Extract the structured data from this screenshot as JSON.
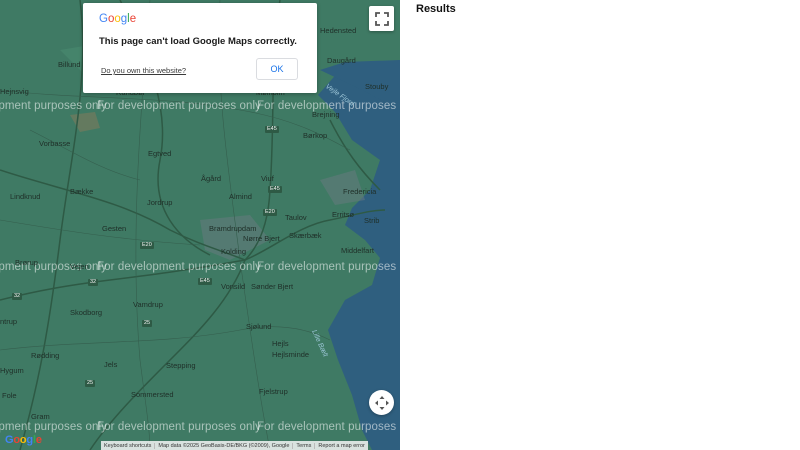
{
  "map": {
    "watermark": "For development purposes only",
    "sea_color": "#2f5f7f",
    "land_color": "#3f7a64",
    "places": [
      {
        "name": "Hedensted"
      },
      {
        "name": "Daugård"
      },
      {
        "name": "Billund"
      },
      {
        "name": "Stouby"
      },
      {
        "name": "Hejnsvig"
      },
      {
        "name": "Randbøl"
      },
      {
        "name": "Mølholm"
      },
      {
        "name": "Brejning"
      },
      {
        "name": "Børkop"
      },
      {
        "name": "Vorbasse"
      },
      {
        "name": "Egtved"
      },
      {
        "name": "Ågård"
      },
      {
        "name": "Viuf"
      },
      {
        "name": "Fredericia"
      },
      {
        "name": "Bække"
      },
      {
        "name": "Lindknud"
      },
      {
        "name": "Jordrup"
      },
      {
        "name": "Almind"
      },
      {
        "name": "Taulov"
      },
      {
        "name": "Erritsø"
      },
      {
        "name": "Strib"
      },
      {
        "name": "Gesten"
      },
      {
        "name": "Bramdrupdam"
      },
      {
        "name": "Skærbæk"
      },
      {
        "name": "Nørre Bjert"
      },
      {
        "name": "Middelfart"
      },
      {
        "name": "Kolding"
      },
      {
        "name": "Brørup"
      },
      {
        "name": "Vejen"
      },
      {
        "name": "Vonsild"
      },
      {
        "name": "Sønder Bjert"
      },
      {
        "name": "Vamdrup"
      },
      {
        "name": "Skodborg"
      },
      {
        "name": "Sjølund"
      },
      {
        "name": "Hejls"
      },
      {
        "name": "Hejlsminde"
      },
      {
        "name": "Rødding"
      },
      {
        "name": "Jels"
      },
      {
        "name": "Stepping"
      },
      {
        "name": "Fjelstrup"
      },
      {
        "name": "Sommersted"
      },
      {
        "name": "Fole"
      },
      {
        "name": "Gram"
      },
      {
        "name": "Hygum"
      },
      {
        "name": "ntrup"
      }
    ],
    "road_labels": [
      "E45",
      "E45",
      "E20",
      "E20",
      "32",
      "32",
      "25",
      "25",
      "E45"
    ],
    "sea_labels": [
      "Vejle Fjord",
      "Lille Bælt"
    ]
  },
  "dialog": {
    "logo_letters": [
      "G",
      "o",
      "o",
      "g",
      "l",
      "e"
    ],
    "message": "This page can't load Google Maps correctly.",
    "link": "Do you own this website?",
    "ok_label": "OK"
  },
  "controls": {
    "fullscreen_icon": "fullscreen-icon",
    "camera_icon": "camera-control-icon"
  },
  "footer": {
    "keyboard": "Keyboard shortcuts",
    "map_data": "Map data ©2025 GeoBasis-DE/BKG (©2009), Google",
    "terms": "Terms",
    "report": "Report a map error"
  },
  "logo_letters": [
    "G",
    "o",
    "o",
    "g",
    "l",
    "e"
  ],
  "results_title": "Results"
}
